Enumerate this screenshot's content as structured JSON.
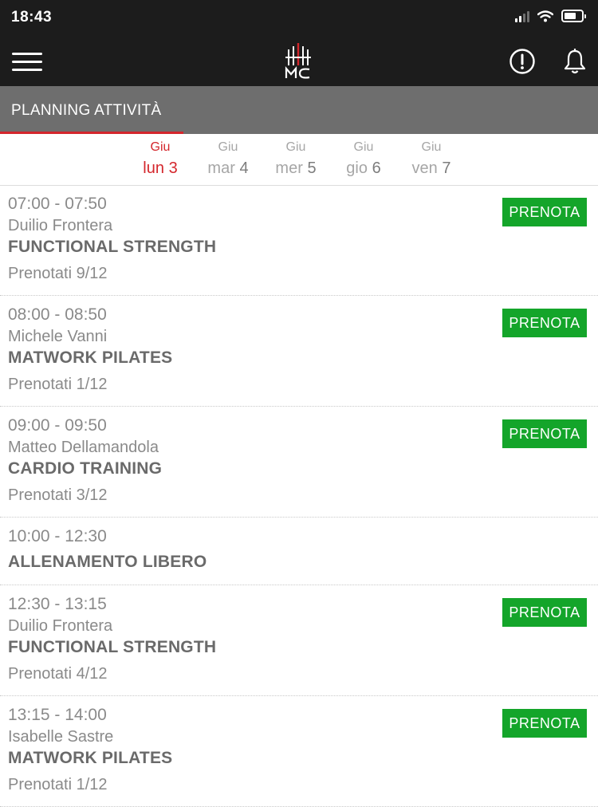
{
  "status": {
    "time": "18:43"
  },
  "section": {
    "title": "PLANNING ATTIVITÀ"
  },
  "days": [
    {
      "month": "Giu",
      "weekday": "lun",
      "day": "3",
      "active": true
    },
    {
      "month": "Giu",
      "weekday": "mar",
      "day": "4",
      "active": false
    },
    {
      "month": "Giu",
      "weekday": "mer",
      "day": "5",
      "active": false
    },
    {
      "month": "Giu",
      "weekday": "gio",
      "day": "6",
      "active": false
    },
    {
      "month": "Giu",
      "weekday": "ven",
      "day": "7",
      "active": false
    }
  ],
  "activities": [
    {
      "time": "07:00 - 07:50",
      "trainer": "Duilio Frontera",
      "course": "FUNCTIONAL STRENGTH",
      "booked": "Prenotati 9/12",
      "button": "PRENOTA"
    },
    {
      "time": "08:00 - 08:50",
      "trainer": "Michele Vanni",
      "course": "MATWORK PILATES",
      "booked": "Prenotati 1/12",
      "button": "PRENOTA"
    },
    {
      "time": "09:00 - 09:50",
      "trainer": "Matteo Dellamandola",
      "course": "CARDIO TRAINING",
      "booked": "Prenotati 3/12",
      "button": "PRENOTA"
    },
    {
      "time": "10:00 - 12:30",
      "trainer": "",
      "course": "ALLENAMENTO LIBERO",
      "booked": "",
      "button": ""
    },
    {
      "time": "12:30 - 13:15",
      "trainer": "Duilio Frontera",
      "course": "FUNCTIONAL STRENGTH",
      "booked": "Prenotati 4/12",
      "button": "PRENOTA"
    },
    {
      "time": "13:15 - 14:00",
      "trainer": "Isabelle Sastre",
      "course": "MATWORK PILATES",
      "booked": "Prenotati 1/12",
      "button": "PRENOTA"
    }
  ],
  "colors": {
    "accent": "#d4262c",
    "book_button": "#14a52a",
    "header": "#1c1c1c",
    "section_bar": "#6e6e6e"
  },
  "icons": {
    "menu": "hamburger-icon",
    "alert": "alert-circle-icon",
    "notifications": "bell-icon"
  }
}
